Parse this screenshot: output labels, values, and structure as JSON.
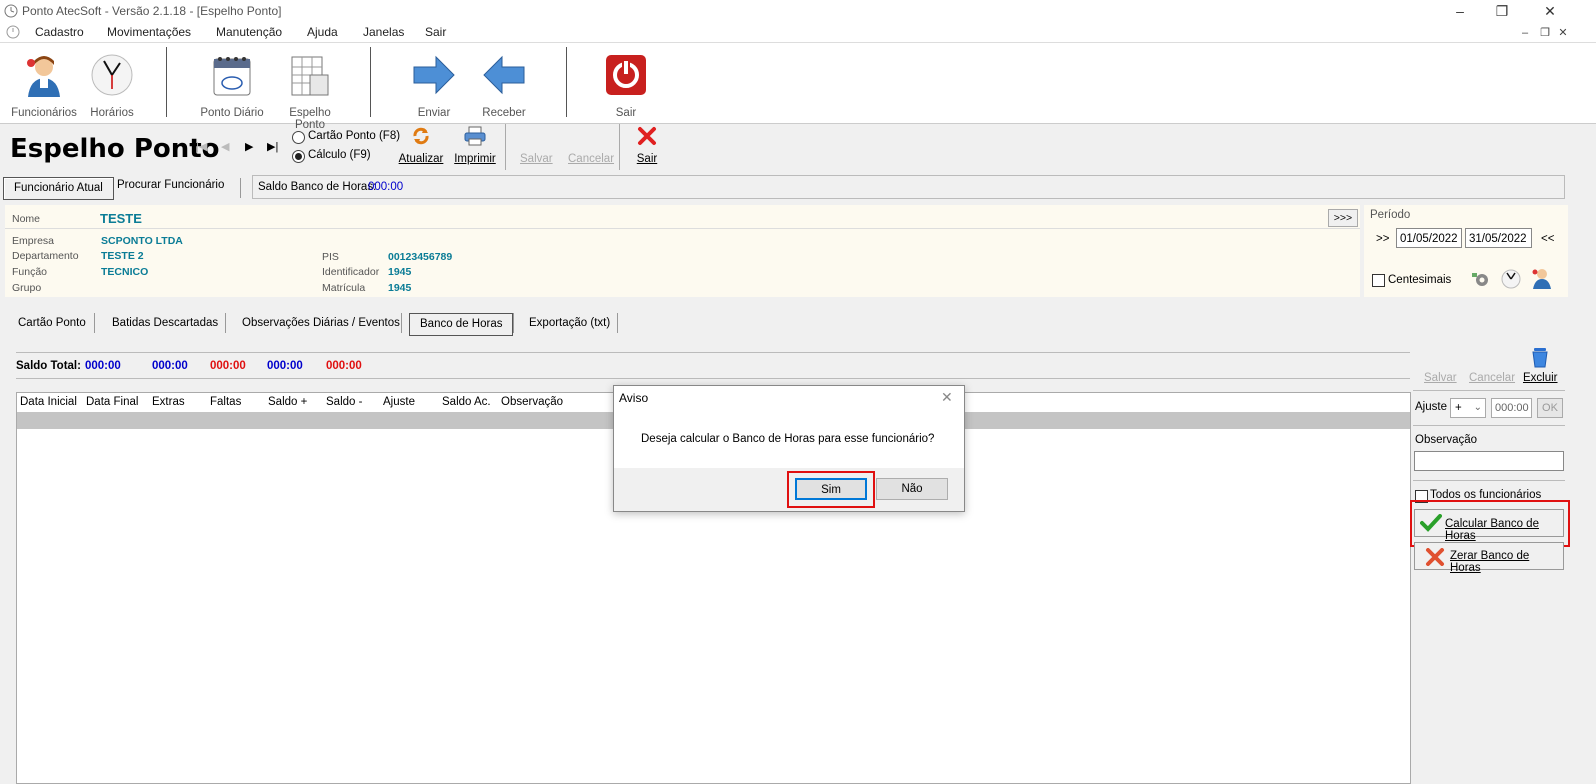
{
  "window": {
    "title": "Ponto AtecSoft - Versão 2.1.18 - [Espelho Ponto]"
  },
  "menu": [
    "Cadastro",
    "Movimentações",
    "Manutenção",
    "Ajuda",
    "Janelas",
    "Sair"
  ],
  "toolbar": {
    "funcionarios": "Funcionários",
    "horarios": "Horários",
    "ponto_diario": "Ponto Diário",
    "espelho_ponto": "Espelho Ponto",
    "enviar": "Enviar",
    "receber": "Receber",
    "sair": "Sair"
  },
  "page": {
    "title": "Espelho Ponto",
    "radio_cartao": "Cartão Ponto (F8)",
    "radio_calculo": "Cálculo (F9)",
    "atualizar": "Atualizar",
    "imprimir": "Imprimir",
    "salvar": "Salvar",
    "cancelar": "Cancelar",
    "sair": "Sair"
  },
  "subtabs": {
    "funcionario_atual": "Funcionário Atual",
    "procurar": "Procurar Funcionário",
    "saldo_label": "Saldo Banco de Horas:",
    "saldo_value": "000:00"
  },
  "employee": {
    "nome_label": "Nome",
    "nome": "TESTE",
    "empresa_label": "Empresa",
    "empresa": "SCPONTO LTDA",
    "departamento_label": "Departamento",
    "departamento": "TESTE 2",
    "funcao_label": "Função",
    "funcao": "TECNICO",
    "grupo_label": "Grupo",
    "pis_label": "PIS",
    "pis": "00123456789",
    "identificador_label": "Identificador",
    "identificador": "1945",
    "matricula_label": "Matrícula",
    "matricula": "1945",
    "expand": ">>>"
  },
  "periodo": {
    "label": "Período",
    "prev": ">>",
    "next": "<<",
    "start": "01/05/2022",
    "end": "31/05/2022",
    "centesimais": "Centesimais"
  },
  "tabs": [
    "Cartão Ponto",
    "Batidas Descartadas",
    "Observações Diárias / Eventos",
    "Banco de Horas",
    "Exportação (txt)"
  ],
  "saldo_total": {
    "label": "Saldo Total:",
    "values": [
      "000:00",
      "000:00",
      "000:00",
      "000:00",
      "000:00"
    ],
    "colors": [
      "#0000cc",
      "#0000cc",
      "#e01010",
      "#0000cc",
      "#e01010"
    ]
  },
  "grid": {
    "columns": [
      "Data Inicial",
      "Data Final",
      "Extras",
      "Faltas",
      "Saldo +",
      "Saldo -",
      "Ajuste",
      "Saldo Ac.",
      "Observação"
    ]
  },
  "right_panel": {
    "salvar": "Salvar",
    "cancelar": "Cancelar",
    "excluir": "Excluir",
    "ajuste_label": "Ajuste",
    "ajuste_sign": "+",
    "ajuste_value": "000:00",
    "ok": "OK",
    "observacao_label": "Observação",
    "todos": "Todos os funcionários",
    "calcular": "Calcular Banco de Horas",
    "zerar": "Zerar Banco de Horas"
  },
  "dialog": {
    "title": "Aviso",
    "message": "Deseja calcular o Banco de Horas para esse funcionário?",
    "sim": "Sim",
    "nao": "Não"
  }
}
